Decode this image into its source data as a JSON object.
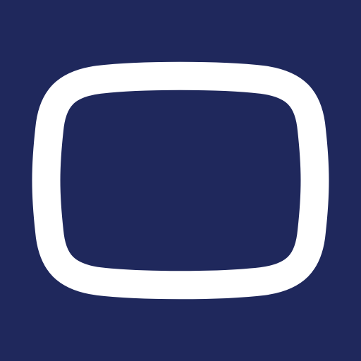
{
  "colors": {
    "background": "#1f285c",
    "outline": "#ffffff"
  },
  "icon": {
    "name": "rounded-rectangle-outline-icon"
  }
}
